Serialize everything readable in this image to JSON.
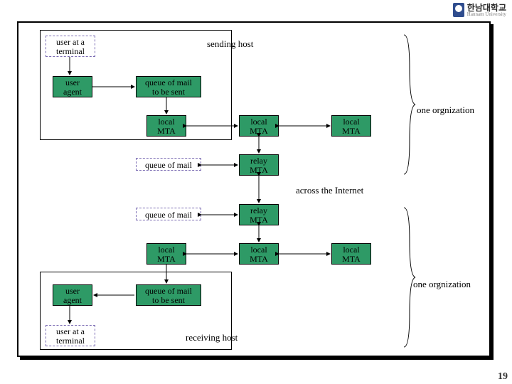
{
  "logo": {
    "kr": "한남대학교",
    "en": "Hannam University"
  },
  "top": {
    "user_terminal": "user at a\nterminal",
    "user_agent": "user\nagent",
    "queue": "queue of mail\nto be sent",
    "sending_host": "sending host",
    "mta1": "local\nMTA",
    "mta2": "local\nMTA",
    "mta3": "local\nMTA"
  },
  "mid": {
    "queue1": "queue of mail",
    "relay1": "relay\nMTA",
    "across": "across the Internet",
    "queue2": "queue of mail",
    "relay2": "relay\nMTA"
  },
  "bottom": {
    "mta1": "local\nMTA",
    "mta2": "local\nMTA",
    "mta3": "local\nMTA",
    "queue": "queue of mail\nto be sent",
    "user_agent": "user\nagent",
    "user_terminal": "user at a\nterminal",
    "receiving_host": "receiving host"
  },
  "org_label": "one orgnization",
  "page_number": "19"
}
